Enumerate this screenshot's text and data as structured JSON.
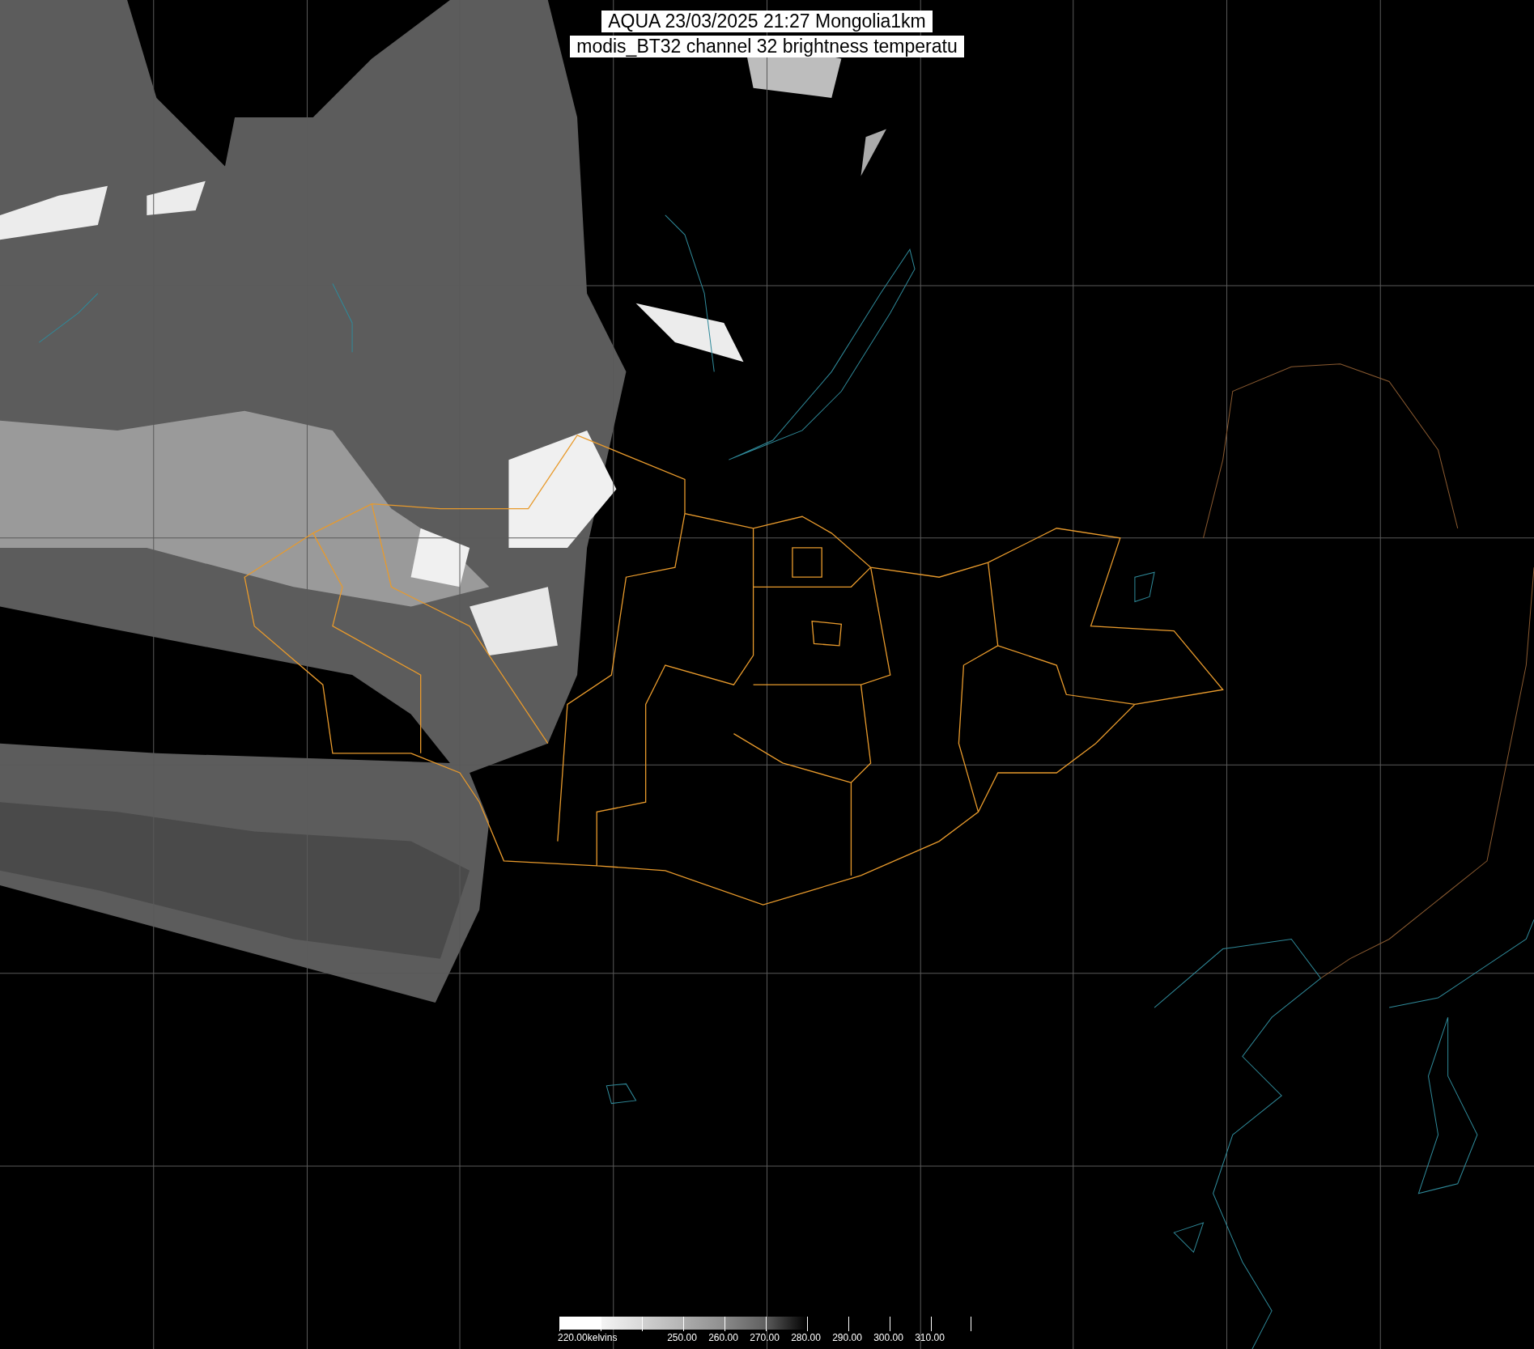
{
  "title": {
    "lines": [
      "AQUA 23/03/2025 21:27 Mongolia1km",
      "modis_BT32 channel 32 brightness temperatu"
    ]
  },
  "colorbar": {
    "first_label": "220.00kelvins",
    "labels": [
      "250.00",
      "260.00",
      "270.00",
      "280.00",
      "290.00",
      "300.00",
      "310.00"
    ]
  }
}
